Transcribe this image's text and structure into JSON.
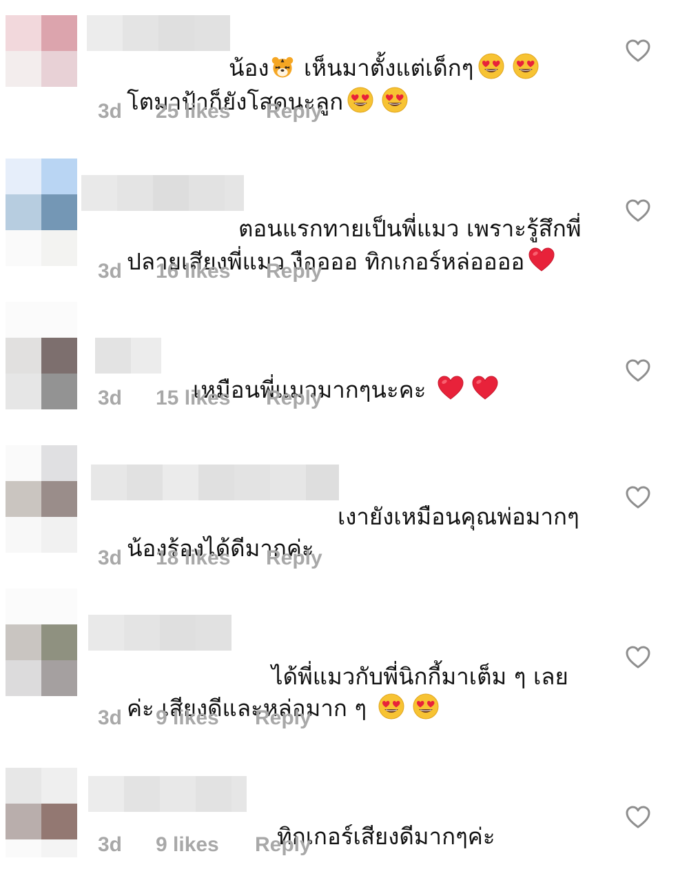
{
  "colors": {
    "meta_text": "#a8a8a8",
    "heart_outline": "#8e8e8e",
    "emoji_face": "#f7c333",
    "emoji_heart": "#e8223a"
  },
  "comments": [
    {
      "text_before": "น้อง",
      "text_after": " เห็นมาตั้งแต่เด็กๆ",
      "inline_icon": "tiger-face-emoji",
      "line2": "โตมาป้าก็ยังโสดนะลูก",
      "line1_emojis": [
        "heart-eyes-emoji",
        "heart-eyes-emoji"
      ],
      "line2_emojis": [
        "heart-eyes-emoji",
        "heart-eyes-emoji"
      ],
      "time": "3d",
      "likes": "25 likes",
      "reply": "Reply"
    },
    {
      "line1": "ตอนแรกทายเป็นพี่แมว เพราะรู้สึกพี่",
      "line2": "ปลายเสียงพี่แมว งืออออ ทิกเกอร์หล่ออออ",
      "line2_emojis": [
        "red-heart-emoji"
      ],
      "time": "3d",
      "likes": "16 likes",
      "reply": "Reply"
    },
    {
      "line1": "เหมือนพี่แมวมากๆนะคะ ",
      "line1_emojis": [
        "red-heart-emoji",
        "red-heart-emoji"
      ],
      "time": "3d",
      "likes": "15 likes",
      "reply": "Reply"
    },
    {
      "line1": "เงายังเหมือนคุณพ่อมากๆ",
      "line2": "น้องร้องได้ดีมากค่ะ",
      "time": "3d",
      "likes": "18 likes",
      "reply": "Reply"
    },
    {
      "line1": "ได้พี่แมวกับพี่นิกกี้มาเต็ม ๆ เลย",
      "line2": "ค่ะ เสียงดีและหล่อมาก ๆ ",
      "line2_emojis": [
        "heart-eyes-emoji",
        "heart-eyes-emoji"
      ],
      "time": "3d",
      "likes": "9 likes",
      "reply": "Reply"
    },
    {
      "line1": "ทิกเกอร์เสียงดีมากๆค่ะ",
      "time": "3d",
      "likes": "9 likes",
      "reply": "Reply"
    }
  ]
}
